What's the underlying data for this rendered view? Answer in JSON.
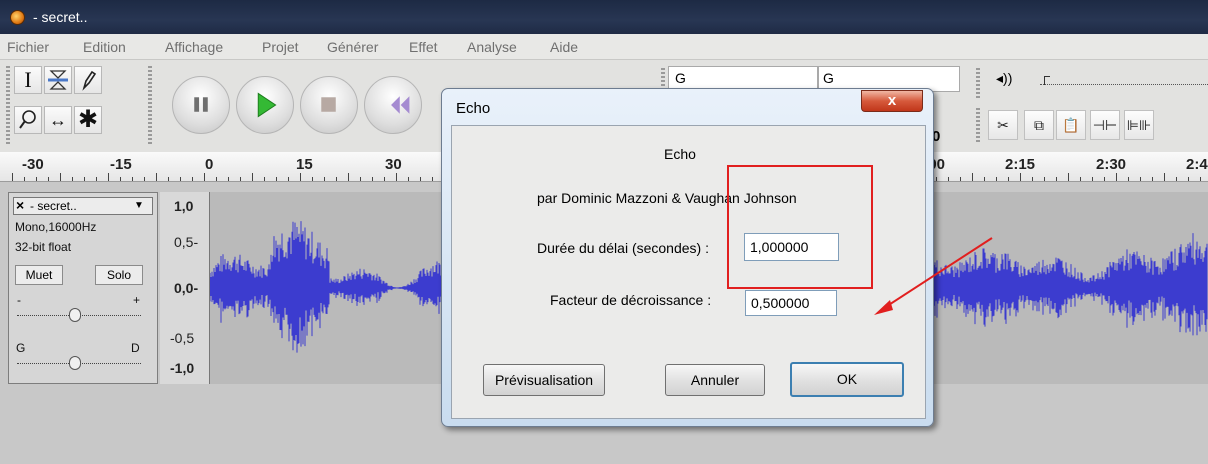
{
  "window": {
    "title": "- secret.."
  },
  "menu": [
    "Fichier",
    "Edition",
    "Affichage",
    "Projet",
    "Générer",
    "Effet",
    "Analyse",
    "Aide"
  ],
  "meters": {
    "left_label": "G",
    "right_label": "G"
  },
  "ruler": {
    "left_labels": [
      "-30",
      "-15",
      "0",
      "15",
      "30"
    ],
    "right_labels": [
      "2:00",
      "2:15",
      "2:30",
      "2:4"
    ]
  },
  "track": {
    "name": "- secret..",
    "format": "Mono,16000Hz",
    "sample": "32-bit float",
    "mute_label": "Muet",
    "solo_label": "Solo",
    "gain_minus": "-",
    "gain_plus": "+",
    "pan_left": "G",
    "pan_right": "D"
  },
  "vruler": [
    "1,0",
    "0,5-",
    "0,0-",
    "-0,5",
    "-1,0"
  ],
  "dialog": {
    "title": "Echo",
    "heading": "Echo",
    "credits": "par Dominic Mazzoni & Vaughan Johnson",
    "delay_label": "Durée du délai (secondes) :",
    "delay_value": "1,000000",
    "decay_label": "Facteur de décroissance :",
    "decay_value": "0,500000",
    "preview_label": "Prévisualisation",
    "cancel_label": "Annuler",
    "ok_label": "OK",
    "close_glyph": "x"
  },
  "colors": {
    "waveform": "#3c3ccf",
    "annotation": "#e11f1f"
  }
}
